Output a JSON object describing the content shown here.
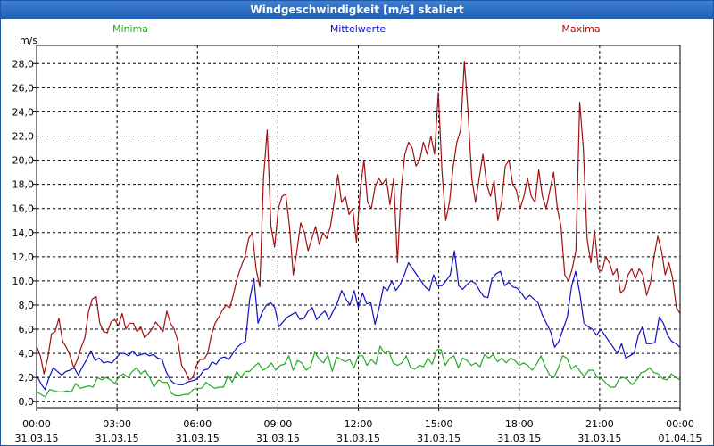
{
  "window_title": "Windgeschwindigkeit [m/s] skaliert",
  "colors": {
    "minima": "#22aa22",
    "mittel": "#1010c0",
    "maxima": "#a01010",
    "grid": "#000000",
    "titlebar": "#2a6cc0"
  },
  "chart_data": {
    "type": "line",
    "title": "Windgeschwindigkeit [m/s] skaliert",
    "ylabel": "m/s",
    "ylim": [
      -0.5,
      29.5
    ],
    "yticks": [
      "0,0",
      "2,0",
      "4,0",
      "6,0",
      "8,0",
      "10,0",
      "12,0",
      "14,0",
      "16,0",
      "18,0",
      "20,0",
      "22,0",
      "24,0",
      "26,0",
      "28,0"
    ],
    "xlim_hours": [
      0,
      24
    ],
    "xticks": [
      {
        "time": "00:00",
        "date": "31.03.15"
      },
      {
        "time": "03:00",
        "date": "31.03.15"
      },
      {
        "time": "06:00",
        "date": "31.03.15"
      },
      {
        "time": "09:00",
        "date": "31.03.15"
      },
      {
        "time": "12:00",
        "date": "31.03.15"
      },
      {
        "time": "15:00",
        "date": "31.03.15"
      },
      {
        "time": "18:00",
        "date": "31.03.15"
      },
      {
        "time": "21:00",
        "date": "31.03.15"
      },
      {
        "time": "00:00",
        "date": "01.04.15"
      }
    ],
    "grid": true,
    "legend_placement": "top",
    "series": [
      {
        "name": "Minima",
        "color": "#22aa22",
        "values": [
          0.8,
          0.6,
          0.4,
          1.0,
          0.9,
          0.8,
          0.8,
          0.9,
          0.8,
          1.5,
          1.1,
          1.2,
          1.3,
          1.2,
          2.0,
          1.8,
          2.0,
          1.8,
          1.5,
          2.1,
          2.3,
          2.0,
          2.5,
          2.8,
          2.3,
          2.6,
          2.0,
          1.2,
          1.8,
          1.6,
          1.6,
          0.7,
          0.5,
          0.5,
          0.6,
          0.6,
          1.0,
          1.1,
          1.1,
          1.6,
          1.3,
          1.1,
          1.2,
          1.2,
          2.2,
          1.6,
          2.5,
          2.0,
          2.5,
          2.5,
          2.9,
          3.2,
          2.6,
          2.8,
          3.2,
          2.6,
          3.0,
          3.1,
          3.8,
          2.6,
          3.4,
          3.2,
          2.6,
          2.9,
          4.1,
          3.5,
          3.2,
          3.9,
          2.5,
          3.7,
          3.5,
          3.3,
          3.5,
          2.8,
          3.8,
          3.8,
          3.0,
          3.5,
          3.1,
          4.6,
          4.0,
          4.2,
          3.2,
          3.0,
          3.2,
          3.8,
          2.8,
          2.7,
          3.0,
          2.9,
          3.6,
          3.1,
          4.3,
          4.3,
          3.0,
          3.6,
          3.8,
          2.8,
          3.6,
          3.4,
          3.0,
          3.2,
          2.9,
          3.9,
          3.6,
          3.9,
          3.3,
          3.6,
          3.2,
          3.6,
          3.4,
          3.0,
          3.2,
          3.0,
          2.6,
          3.1,
          3.8,
          2.9,
          2.2,
          2.0,
          2.8,
          3.8,
          3.6,
          2.7,
          3.0,
          2.5,
          2.1,
          2.6,
          2.6,
          2.0,
          1.9,
          1.5,
          1.2,
          1.2,
          1.9,
          2.0,
          1.8,
          1.4,
          1.8,
          2.4,
          2.5,
          2.8,
          2.4,
          2.3,
          1.9,
          1.8,
          2.3,
          2.0,
          1.8
        ]
      },
      {
        "name": "Mittelwerte",
        "color": "#1010c0",
        "values": [
          2.2,
          1.5,
          1.0,
          2.0,
          2.8,
          2.5,
          2.2,
          2.5,
          2.6,
          2.8,
          2.2,
          2.9,
          3.5,
          4.2,
          3.4,
          3.6,
          3.2,
          3.3,
          3.2,
          3.6,
          4.0,
          4.0,
          3.8,
          4.2,
          3.8,
          3.9,
          4.0,
          3.8,
          3.9,
          3.6,
          3.5,
          2.5,
          1.8,
          1.5,
          1.4,
          1.4,
          1.6,
          1.7,
          1.8,
          2.1,
          2.6,
          2.7,
          3.3,
          3.1,
          3.6,
          3.7,
          3.5,
          4.0,
          4.5,
          4.8,
          5.0,
          8.5,
          10.2,
          6.5,
          7.4,
          8.0,
          8.2,
          7.8,
          6.2,
          6.6,
          7.0,
          7.2,
          7.4,
          6.8,
          6.9,
          7.5,
          7.8,
          6.8,
          7.2,
          7.5,
          6.8,
          7.5,
          8.2,
          9.2,
          8.5,
          8.0,
          9.2,
          7.8,
          9.0,
          8.1,
          8.2,
          6.4,
          7.8,
          9.5,
          9.2,
          10.0,
          9.2,
          9.7,
          10.5,
          11.5,
          11.0,
          10.5,
          10.0,
          9.5,
          9.2,
          10.5,
          9.6,
          9.6,
          10.0,
          10.5,
          12.5,
          9.6,
          9.3,
          9.7,
          10.0,
          9.8,
          9.2,
          8.7,
          8.6,
          10.2,
          10.6,
          10.8,
          9.6,
          9.9,
          9.5,
          9.4,
          9.0,
          8.5,
          8.8,
          8.5,
          8.2,
          7.2,
          6.5,
          5.8,
          4.5,
          5.0,
          6.0,
          7.0,
          9.5,
          10.8,
          9.0,
          6.5,
          6.2,
          6.0,
          5.5,
          6.0,
          5.5,
          5.0,
          4.5,
          4.0,
          4.8,
          3.6,
          3.8,
          4.0,
          5.5,
          6.2,
          4.8,
          4.8,
          4.9,
          7.0,
          6.5,
          5.5,
          5.0,
          4.8,
          4.5
        ]
      },
      {
        "name": "Maxima",
        "color": "#a01010",
        "values": [
          4.6,
          3.8,
          2.3,
          3.6,
          5.6,
          5.8,
          6.9,
          5.0,
          4.5,
          3.8,
          2.8,
          3.5,
          4.5,
          5.3,
          7.5,
          8.5,
          8.7,
          6.5,
          5.8,
          5.7,
          6.6,
          6.8,
          6.3,
          7.3,
          6.0,
          6.5,
          6.5,
          5.8,
          6.2,
          5.3,
          5.6,
          6.0,
          6.6,
          6.2,
          5.8,
          7.5,
          6.5,
          6.0,
          5.0,
          3.0,
          2.5,
          1.8,
          2.0,
          3.0,
          3.5,
          3.5,
          4.0,
          5.5,
          6.5,
          7.0,
          7.6,
          8.0,
          7.8,
          9.0,
          10.3,
          11.2,
          12.0,
          13.5,
          14.0,
          11.0,
          9.5,
          18.5,
          22.5,
          14.5,
          12.8,
          16.0,
          17.0,
          17.2,
          14.5,
          10.5,
          12.5,
          14.8,
          14.0,
          12.5,
          13.5,
          14.5,
          13.0,
          14.0,
          13.5,
          14.5,
          16.5,
          18.8,
          16.5,
          17.0,
          15.5,
          16.0,
          13.2,
          17.5,
          20.0,
          16.5,
          16.0,
          17.8,
          18.5,
          18.0,
          18.5,
          16.3,
          18.5,
          11.5,
          17.5,
          20.5,
          21.5,
          21.0,
          19.5,
          20.0,
          21.5,
          20.5,
          22.0,
          20.5,
          25.6,
          19.0,
          15.0,
          16.5,
          19.5,
          21.5,
          22.5,
          28.2,
          24.0,
          18.5,
          16.5,
          18.5,
          20.5,
          18.0,
          17.0,
          18.3,
          15.0,
          16.5,
          19.5,
          20.0,
          18.0,
          17.5,
          16.0,
          17.0,
          18.5,
          17.0,
          16.5,
          19.2,
          17.0,
          16.0,
          17.5,
          19.0,
          16.0,
          14.5,
          10.5,
          10.0,
          11.0,
          12.5,
          24.8,
          21.0,
          13.5,
          11.5,
          14.2,
          11.0,
          10.8,
          12.0,
          11.5,
          10.5,
          11.0,
          9.0,
          9.3,
          10.5,
          11.0,
          10.2,
          11.0,
          10.5,
          8.8,
          9.8,
          12.0,
          13.7,
          12.5,
          10.5,
          11.5,
          10.2,
          7.8,
          7.3
        ]
      }
    ]
  }
}
